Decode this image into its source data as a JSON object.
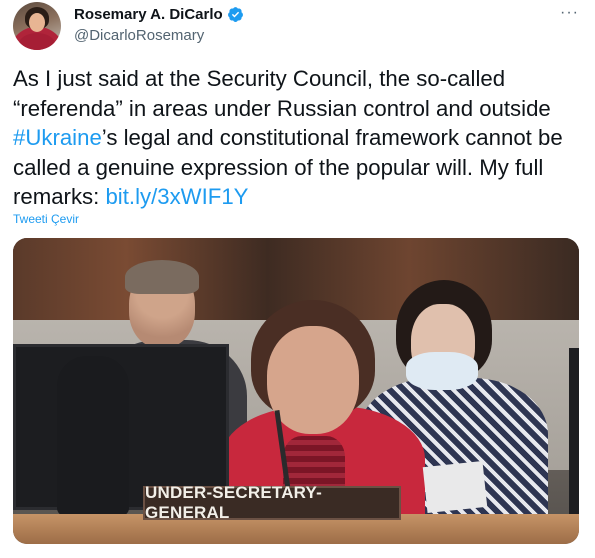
{
  "author": {
    "display_name": "Rosemary A. DiCarlo",
    "handle": "@DicarloRosemary",
    "verified": true
  },
  "menu": {
    "more_label": "···"
  },
  "tweet": {
    "text_part1": "As I just said at the Security Council, the so-called “referenda” in areas under Russian control and outside ",
    "hashtag": "#Ukraine",
    "text_part2": "’s legal and constitutional framework cannot be called a genuine expression of the popular will. My full remarks: ",
    "link": "bit.ly/3xWIF1Y",
    "translate_label": "Tweeti Çevir"
  },
  "media": {
    "nameplate_text": "UNDER-SECRETARY-GENERAL"
  },
  "colors": {
    "link": "#1d9bf0",
    "verified_badge": "#1d9bf0",
    "secondary_text": "#536471"
  }
}
